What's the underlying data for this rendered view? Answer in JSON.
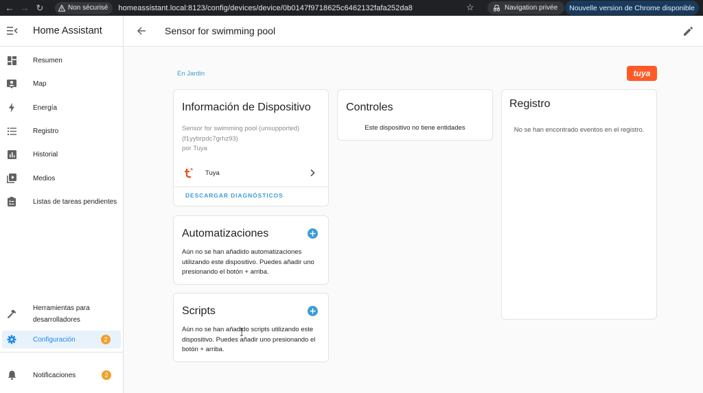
{
  "browser": {
    "security_label": "Non sécurisé",
    "url": "homeassistant.local:8123/config/devices/device/0b0147f9718625c6462132fafa252da8",
    "incognito_label": "Navigation privée",
    "update_label": "Nouvelle version de Chrome disponible"
  },
  "sidebar": {
    "title": "Home Assistant",
    "items": [
      {
        "label": "Resumen",
        "icon": "dashboard-icon"
      },
      {
        "label": "Map",
        "icon": "map-icon"
      },
      {
        "label": "Energía",
        "icon": "lightning-icon"
      },
      {
        "label": "Registro",
        "icon": "list-icon"
      },
      {
        "label": "Historial",
        "icon": "chart-icon"
      },
      {
        "label": "Medios",
        "icon": "media-icon"
      },
      {
        "label": "Listas de tareas pendientes",
        "icon": "clipboard-icon"
      }
    ],
    "dev_tools": {
      "line1": "Herramientas para",
      "line2": "desarrolladores"
    },
    "settings": {
      "label": "Configuración",
      "badge": "2"
    },
    "notifications": {
      "label": "Notificaciones",
      "badge": "2"
    }
  },
  "header": {
    "title": "Sensor for swimming pool"
  },
  "main": {
    "area_link": "En Jardin",
    "brand_logo_text": "tuya",
    "info_card": {
      "title": "Información de Dispositivo",
      "desc_line1": "Sensor for swimming pool (unsupported)",
      "desc_line2": "(f1yybrpdc7grhz93)",
      "desc_line3": "por Tuya",
      "integration": "Tuya",
      "download_button": "DESCARGAR DIAGNÓSTICOS"
    },
    "automations_card": {
      "title": "Automatizaciones",
      "body": "Aún no se han añadido automatizaciones utilizando este dispositivo. Puedes añadir uno presionando el botón + arriba."
    },
    "scripts_card": {
      "title": "Scripts",
      "body": "Aún no se han añadido scripts utilizando este dispositivo. Puedes añadir uno presionando el botón + arriba."
    },
    "controls_card": {
      "title": "Controles",
      "body": "Este dispositivo no tiene entidades"
    },
    "log_card": {
      "title": "Registro",
      "body": "No se han encontrado eventos en el registro."
    }
  },
  "colors": {
    "accent": "#1e88e5",
    "link": "#3d9bd6",
    "badge": "#f0a030",
    "tuya": "#ff5a28"
  }
}
